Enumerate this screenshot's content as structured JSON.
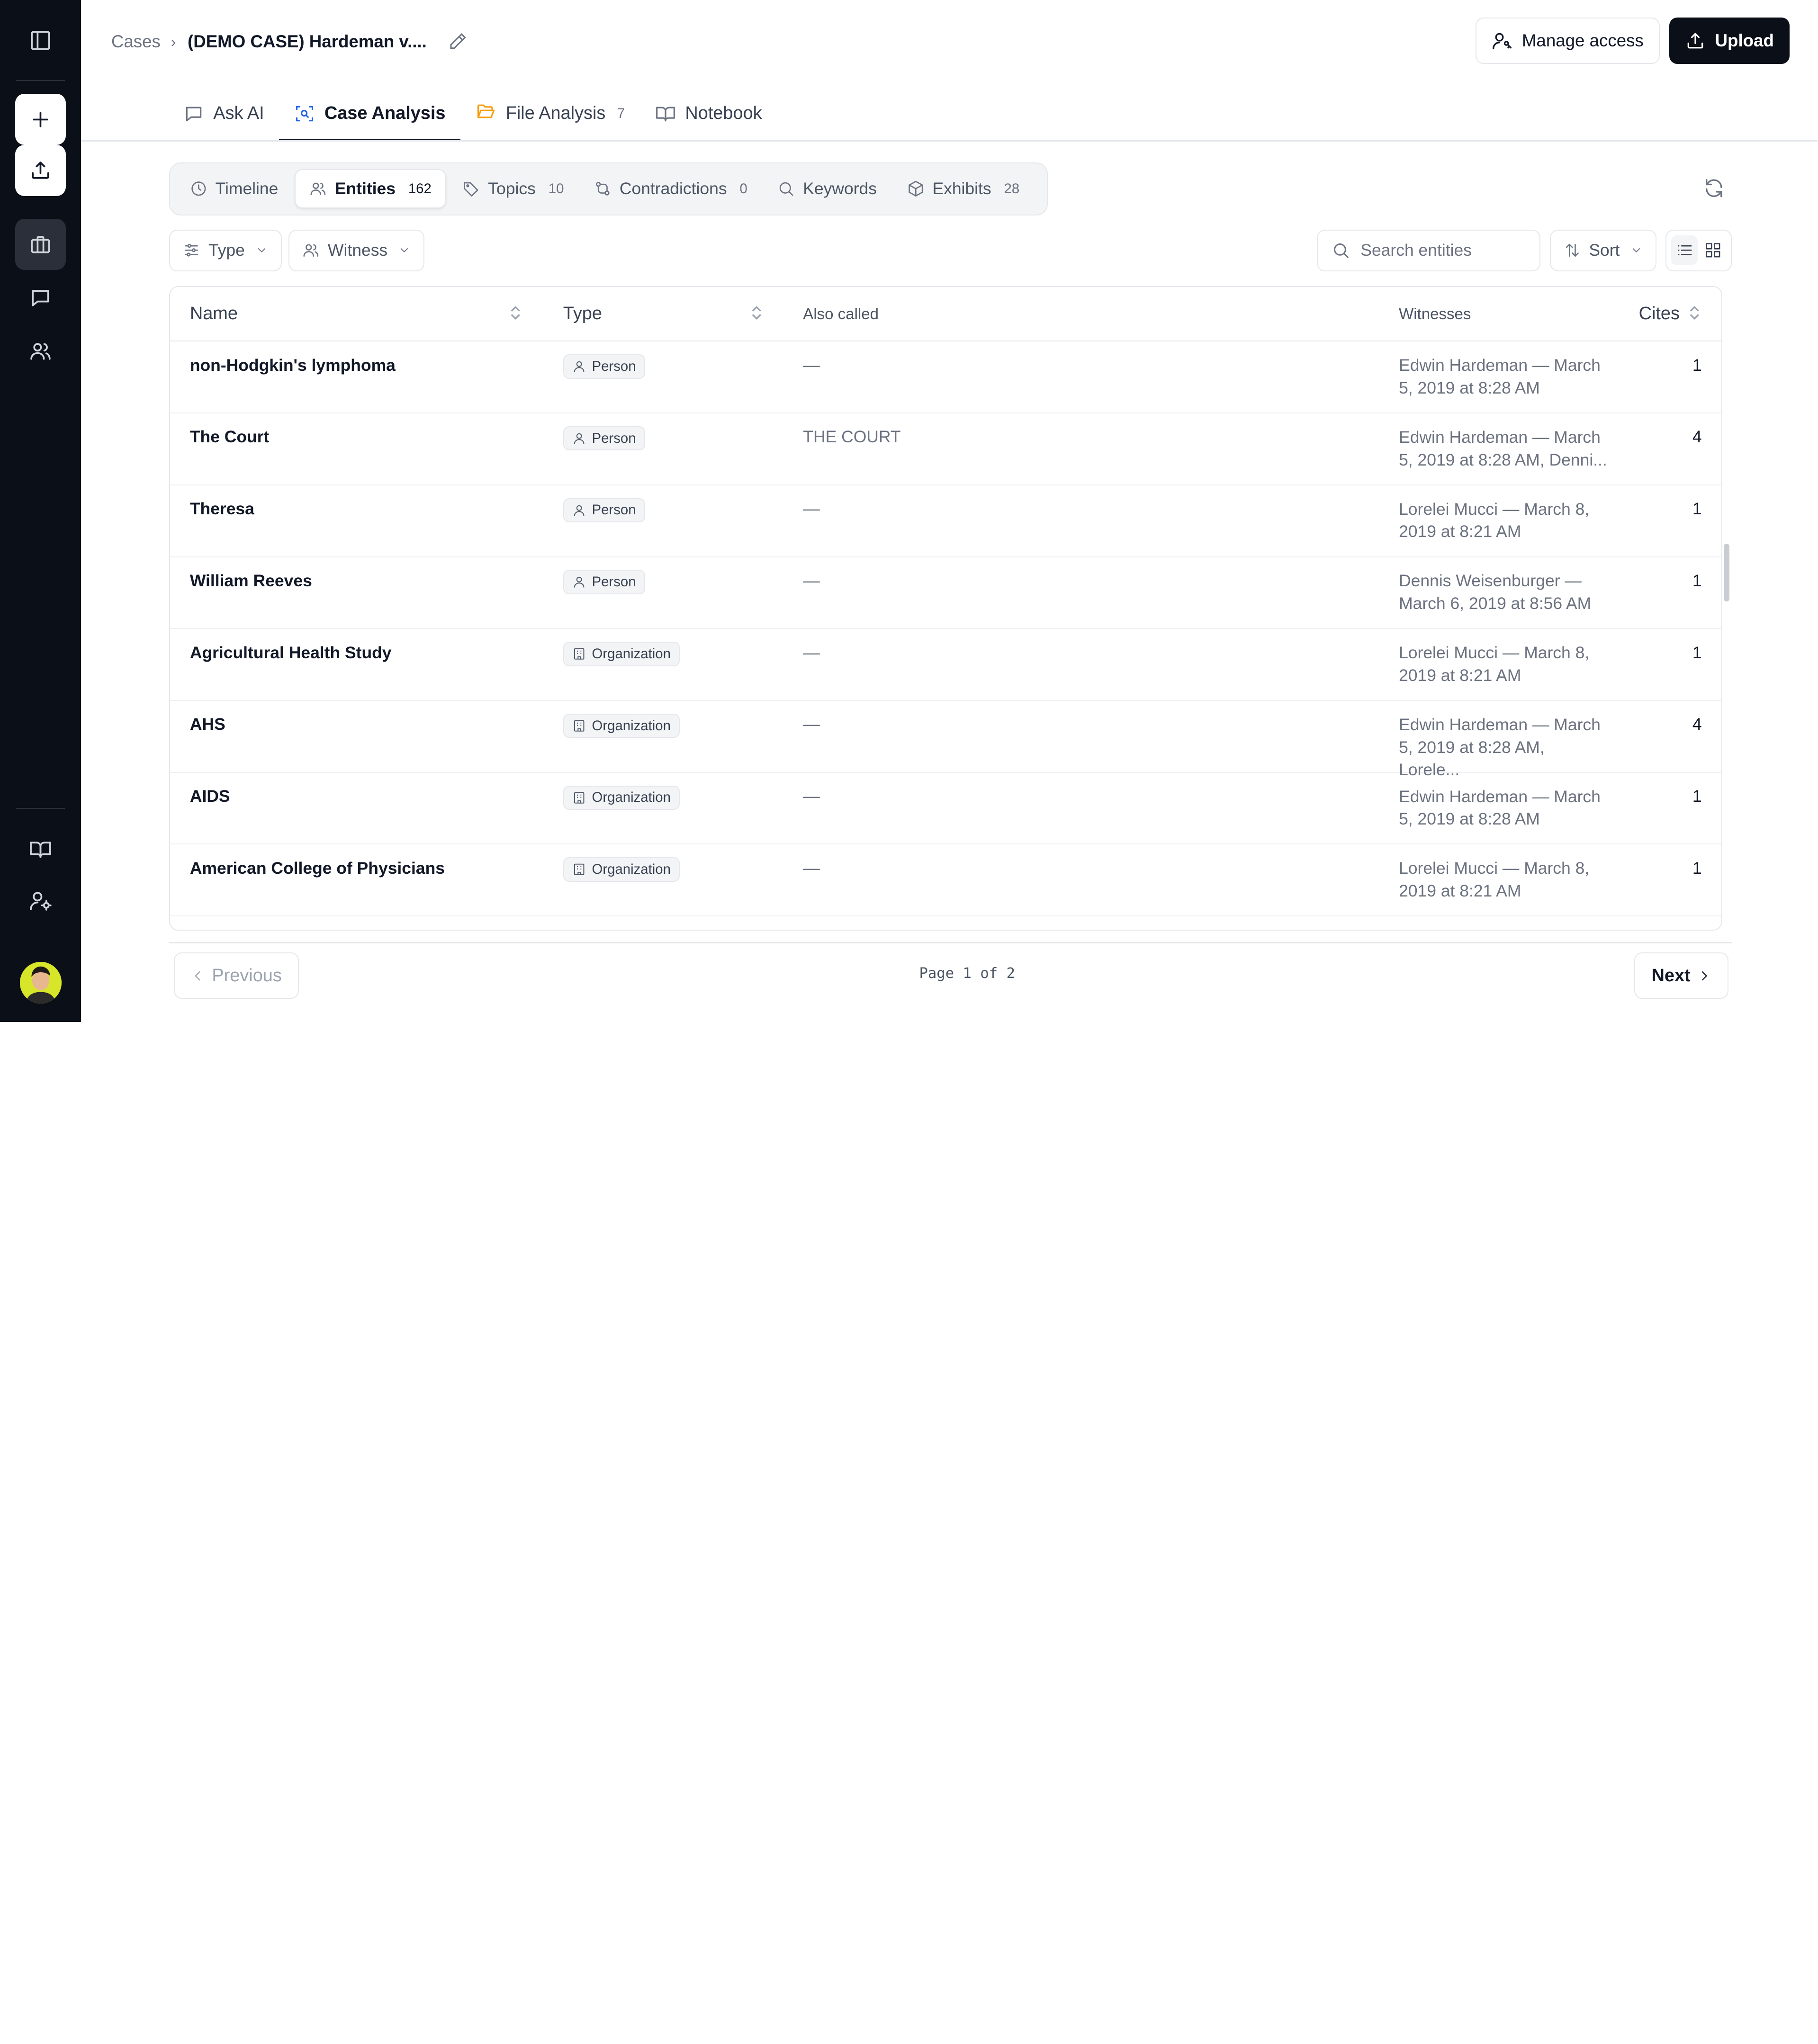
{
  "breadcrumb": {
    "root": "Cases",
    "current": "(DEMO CASE) Hardeman v...."
  },
  "header": {
    "manage_access": "Manage access",
    "upload": "Upload"
  },
  "tabs": [
    {
      "label": "Ask AI",
      "icon": "message-square-icon",
      "count": ""
    },
    {
      "label": "Case Analysis",
      "icon": "scan-search-icon",
      "count": "",
      "active": true
    },
    {
      "label": "File Analysis",
      "icon": "folder-open-icon",
      "count": "7"
    },
    {
      "label": "Notebook",
      "icon": "book-open-icon",
      "count": ""
    }
  ],
  "subtabs": [
    {
      "label": "Timeline",
      "icon": "clock-icon",
      "count": ""
    },
    {
      "label": "Entities",
      "icon": "users-icon",
      "count": "162",
      "active": true
    },
    {
      "label": "Topics",
      "icon": "tag-icon",
      "count": "10"
    },
    {
      "label": "Contradictions",
      "icon": "git-compare-icon",
      "count": "0"
    },
    {
      "label": "Keywords",
      "icon": "search-icon",
      "count": ""
    },
    {
      "label": "Exhibits",
      "icon": "package-icon",
      "count": "28"
    }
  ],
  "filters": {
    "type_label": "Type",
    "witness_label": "Witness",
    "sort_label": "Sort",
    "search_placeholder": "Search entities"
  },
  "table": {
    "columns": {
      "name": "Name",
      "type": "Type",
      "also": "Also called",
      "witnesses": "Witnesses",
      "cites": "Cites"
    },
    "rows": [
      {
        "name": "non-Hodgkin's lymphoma",
        "type": "Person",
        "also": "—",
        "witnesses": "Edwin Hardeman — March 5, 2019 at 8:28 AM",
        "cites": "1"
      },
      {
        "name": "The Court",
        "type": "Person",
        "also": "THE COURT",
        "witnesses": "Edwin Hardeman — March 5, 2019 at 8:28 AM, Denni...",
        "cites": "4"
      },
      {
        "name": "Theresa",
        "type": "Person",
        "also": "—",
        "witnesses": "Lorelei Mucci — March 8, 2019 at 8:21 AM",
        "cites": "1"
      },
      {
        "name": "William Reeves",
        "type": "Person",
        "also": "—",
        "witnesses": "Dennis Weisenburger — March 6, 2019 at 8:56 AM",
        "cites": "1"
      },
      {
        "name": "Agricultural Health Study",
        "type": "Organization",
        "also": "—",
        "witnesses": "Lorelei Mucci — March 8, 2019 at 8:21 AM",
        "cites": "1"
      },
      {
        "name": "AHS",
        "type": "Organization",
        "also": "—",
        "witnesses": "Edwin Hardeman — March 5, 2019 at 8:28 AM, Lorele...",
        "cites": "4"
      },
      {
        "name": "AIDS",
        "type": "Organization",
        "also": "—",
        "witnesses": "Edwin Hardeman — March 5, 2019 at 8:28 AM",
        "cites": "1"
      },
      {
        "name": "American College of Physicians",
        "type": "Organization",
        "also": "—",
        "witnesses": "Lorelei Mucci — March 8, 2019 at 8:21 AM",
        "cites": "1"
      }
    ]
  },
  "pagination": {
    "previous": "Previous",
    "next": "Next",
    "page_text": "Page 1 of 2"
  }
}
